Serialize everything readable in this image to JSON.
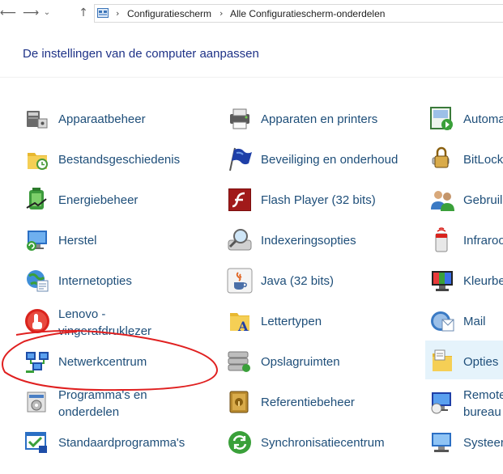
{
  "breadcrumb": [
    "Configuratiescherm",
    "Alle Configuratiescherm-onderdelen"
  ],
  "heading": "De instellingen van de computer aanpassen",
  "items": {
    "c1": [
      {
        "label": "Apparaatbeheer",
        "icon": "device-manager-icon"
      },
      {
        "label": "Bestandsgeschiedenis",
        "icon": "file-history-icon"
      },
      {
        "label": "Energiebeheer",
        "icon": "power-options-icon"
      },
      {
        "label": "Herstel",
        "icon": "recovery-icon"
      },
      {
        "label": "Internetopties",
        "icon": "internet-options-icon"
      },
      {
        "label": "Lenovo -\nvingerafdruklezer",
        "icon": "fingerprint-icon"
      },
      {
        "label": "Netwerkcentrum",
        "icon": "network-center-icon"
      },
      {
        "label": "Programma's en\nonderdelen",
        "icon": "programs-icon"
      },
      {
        "label": "Standaardprogramma's",
        "icon": "default-programs-icon"
      }
    ],
    "c2": [
      {
        "label": "Apparaten en printers",
        "icon": "devices-printers-icon"
      },
      {
        "label": "Beveiliging en onderhoud",
        "icon": "security-flag-icon"
      },
      {
        "label": "Flash Player (32 bits)",
        "icon": "flash-icon"
      },
      {
        "label": "Indexeringsopties",
        "icon": "indexing-icon"
      },
      {
        "label": "Java (32 bits)",
        "icon": "java-icon"
      },
      {
        "label": "Lettertypen",
        "icon": "fonts-icon"
      },
      {
        "label": "Opslagruimten",
        "icon": "storage-spaces-icon"
      },
      {
        "label": "Referentiebeheer",
        "icon": "credential-manager-icon"
      },
      {
        "label": "Synchronisatiecentrum",
        "icon": "sync-center-icon"
      }
    ],
    "c3": [
      {
        "label": "Automa",
        "icon": "autoplay-icon"
      },
      {
        "label": "BitLock",
        "icon": "bitlocker-icon"
      },
      {
        "label": "Gebruil",
        "icon": "users-icon"
      },
      {
        "label": "Infraroo",
        "icon": "infrared-icon"
      },
      {
        "label": "Kleurbe",
        "icon": "color-management-icon"
      },
      {
        "label": "Mail",
        "icon": "mail-icon"
      },
      {
        "label": "Opties",
        "icon": "folder-options-icon"
      },
      {
        "label": "Remote\nbureau",
        "icon": "remote-desktop-icon"
      },
      {
        "label": "Systeer",
        "icon": "system-icon"
      }
    ]
  },
  "colors": {
    "link": "#1e4e79",
    "heading": "#1e3287",
    "highlight": "#e5f3fb",
    "annotation": "#e02020"
  }
}
